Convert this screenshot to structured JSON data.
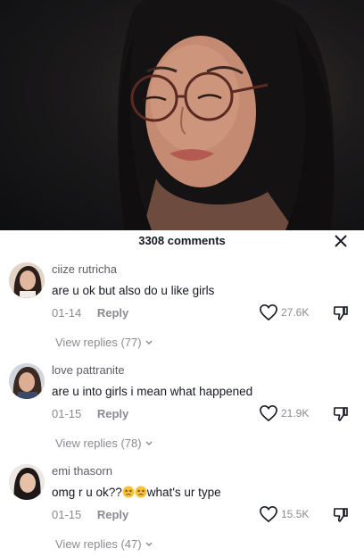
{
  "panel": {
    "title": "3308 comments"
  },
  "comments": [
    {
      "username": "ciize rutricha",
      "text": "are u ok but also do u like girls",
      "date": "01-14",
      "reply_label": "Reply",
      "likes": "27.6K",
      "view_replies": "View replies (77)"
    },
    {
      "username": "love pattranite",
      "text": "are u into girls i mean what happened",
      "date": "01-15",
      "reply_label": "Reply",
      "likes": "21.9K",
      "view_replies": "View replies (78)"
    },
    {
      "username": "emi thasorn",
      "text_before": "omg r u ok??",
      "emoji": "😣😣",
      "text_after": "what's ur type",
      "date": "01-15",
      "reply_label": "Reply",
      "likes": "15.5K",
      "view_replies": "View replies (47)"
    }
  ],
  "icons": {
    "close": "close-icon",
    "like": "heart-outline-icon",
    "dislike": "thumbs-down-outline-icon",
    "chevron": "chevron-down-icon"
  },
  "colors": {
    "primary_text": "#161823",
    "secondary_text": "#8a8b91",
    "background": "#ffffff"
  }
}
